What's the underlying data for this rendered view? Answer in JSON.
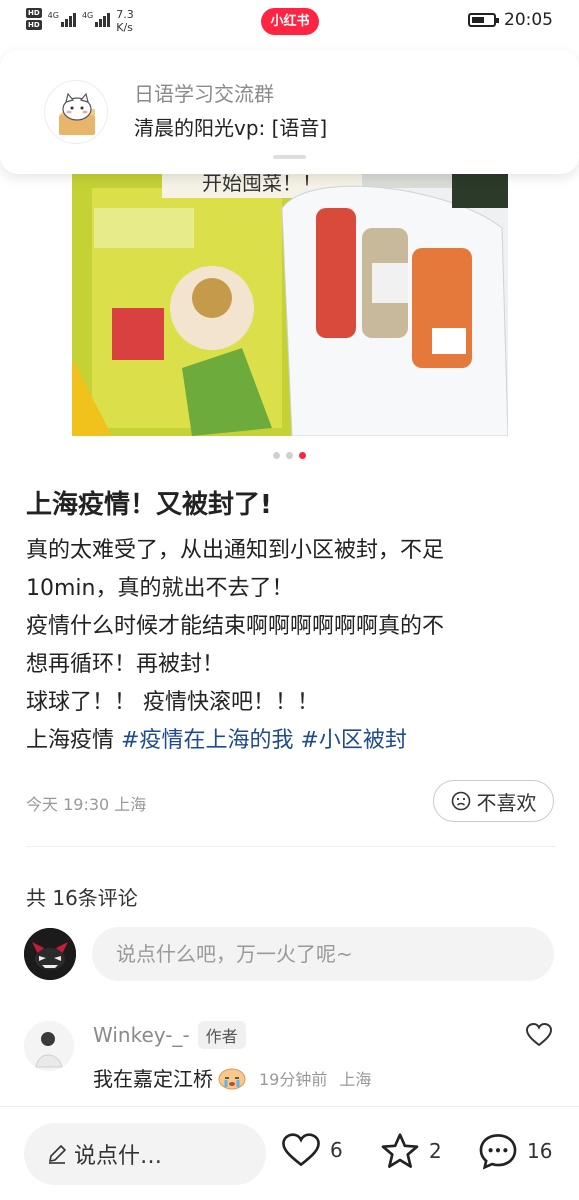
{
  "status_bar": {
    "hd_labels": [
      "HD",
      "HD"
    ],
    "sim_labels": [
      "4G",
      "4G"
    ],
    "net_speed_value": "7.3",
    "net_speed_unit": "K/s",
    "app_badge": "小红书",
    "time": "20:05",
    "battery_level": 0.6
  },
  "notification": {
    "group_name": "日语学习交流群",
    "message": "清晨的阳光vp: [语音]"
  },
  "post": {
    "image_overlay_text": "开始囤菜！！",
    "image_count": 3,
    "active_image": 3,
    "title": "上海疫情！又被封了!",
    "body_lines": [
      "真的太难受了，从出通知到小区被封，不足",
      "10min，真的就出不去了！",
      "疫情什么时候才能结束啊啊啊啊啊啊真的不",
      "想再循环！再被封！",
      "球球了！！ 疫情快滚吧！！！"
    ],
    "last_line_text": "上海疫情",
    "tags": [
      "#疫情在上海的我",
      "#小区被封"
    ],
    "meta": "今天 19:30 上海",
    "dislike_label": "不喜欢"
  },
  "comments": {
    "count_label": "共 16条评论",
    "input_placeholder": "说点什么吧，万一火了呢~",
    "items": [
      {
        "author": "Winkey-_-",
        "badge": "作者",
        "text": "我在嘉定江桥",
        "time": "19分钟前",
        "location": "上海"
      }
    ]
  },
  "bottom_bar": {
    "input_label": "说点什…",
    "likes": "6",
    "stars": "2",
    "comments": "16"
  },
  "colors": {
    "brand": "#ff2442",
    "tag": "#1e4b8f",
    "muted": "#999999"
  }
}
